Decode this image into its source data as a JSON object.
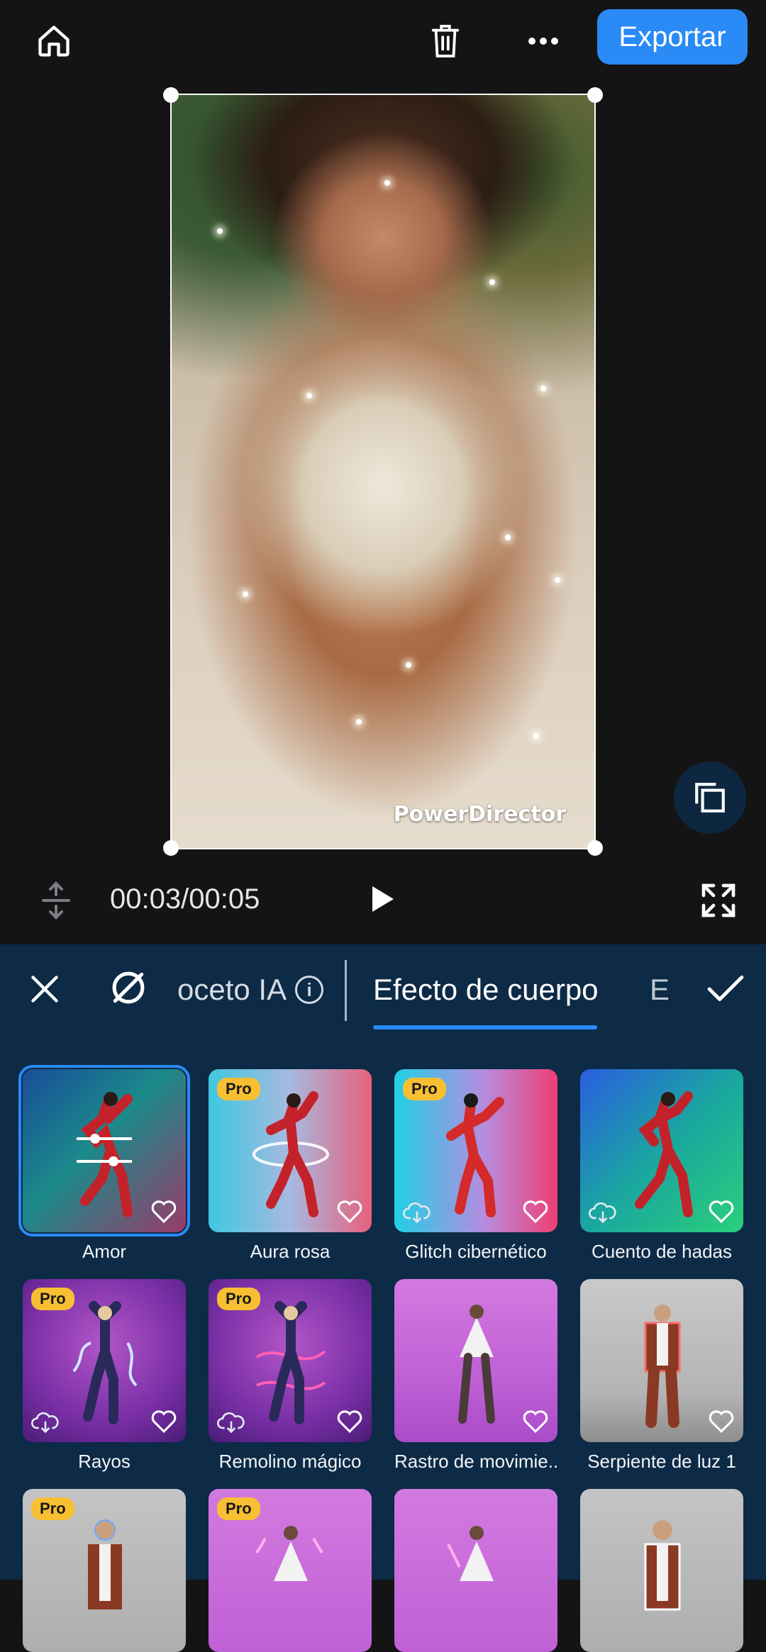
{
  "topbar": {
    "home_icon": "home-icon",
    "delete_icon": "trash-icon",
    "more_icon": "more-dots-icon",
    "export_label": "Exportar",
    "accent": "#2a8af6"
  },
  "preview": {
    "watermark": "PowerDirector",
    "copy_icon": "layers-copy-icon"
  },
  "playback": {
    "time": "00:03/00:05",
    "split_icon": "split-vertical-icon",
    "play_icon": "play-icon",
    "fullscreen_icon": "fullscreen-icon"
  },
  "panel": {
    "close_icon": "close-icon",
    "none_icon": "no-effect-icon",
    "tabs": [
      {
        "label": "oceto IA",
        "info_icon": "info-icon"
      },
      {
        "label": "Efecto de cuerpo",
        "active": true
      },
      {
        "label": "E"
      }
    ],
    "confirm_icon": "checkmark-icon"
  },
  "effects": [
    {
      "label": "Amor",
      "pro": false,
      "selected": true,
      "download": false
    },
    {
      "label": "Aura rosa",
      "pro": true,
      "selected": false,
      "download": false
    },
    {
      "label": "Glitch cibernético",
      "pro": true,
      "selected": false,
      "download": true
    },
    {
      "label": "Cuento de hadas",
      "pro": false,
      "selected": false,
      "download": true
    },
    {
      "label": "Rayos",
      "pro": true,
      "selected": false,
      "download": true
    },
    {
      "label": "Remolino mágico",
      "pro": true,
      "selected": false,
      "download": true
    },
    {
      "label": "Rastro de movimie..",
      "pro": false,
      "selected": false,
      "download": false
    },
    {
      "label": "Serpiente de luz 1",
      "pro": false,
      "selected": false,
      "download": false
    },
    {
      "label": "",
      "pro": true,
      "selected": false,
      "download": false
    },
    {
      "label": "",
      "pro": true,
      "selected": false,
      "download": false
    },
    {
      "label": "",
      "pro": false,
      "selected": false,
      "download": false
    },
    {
      "label": "",
      "pro": false,
      "selected": false,
      "download": false
    }
  ],
  "pro_badge": "Pro"
}
